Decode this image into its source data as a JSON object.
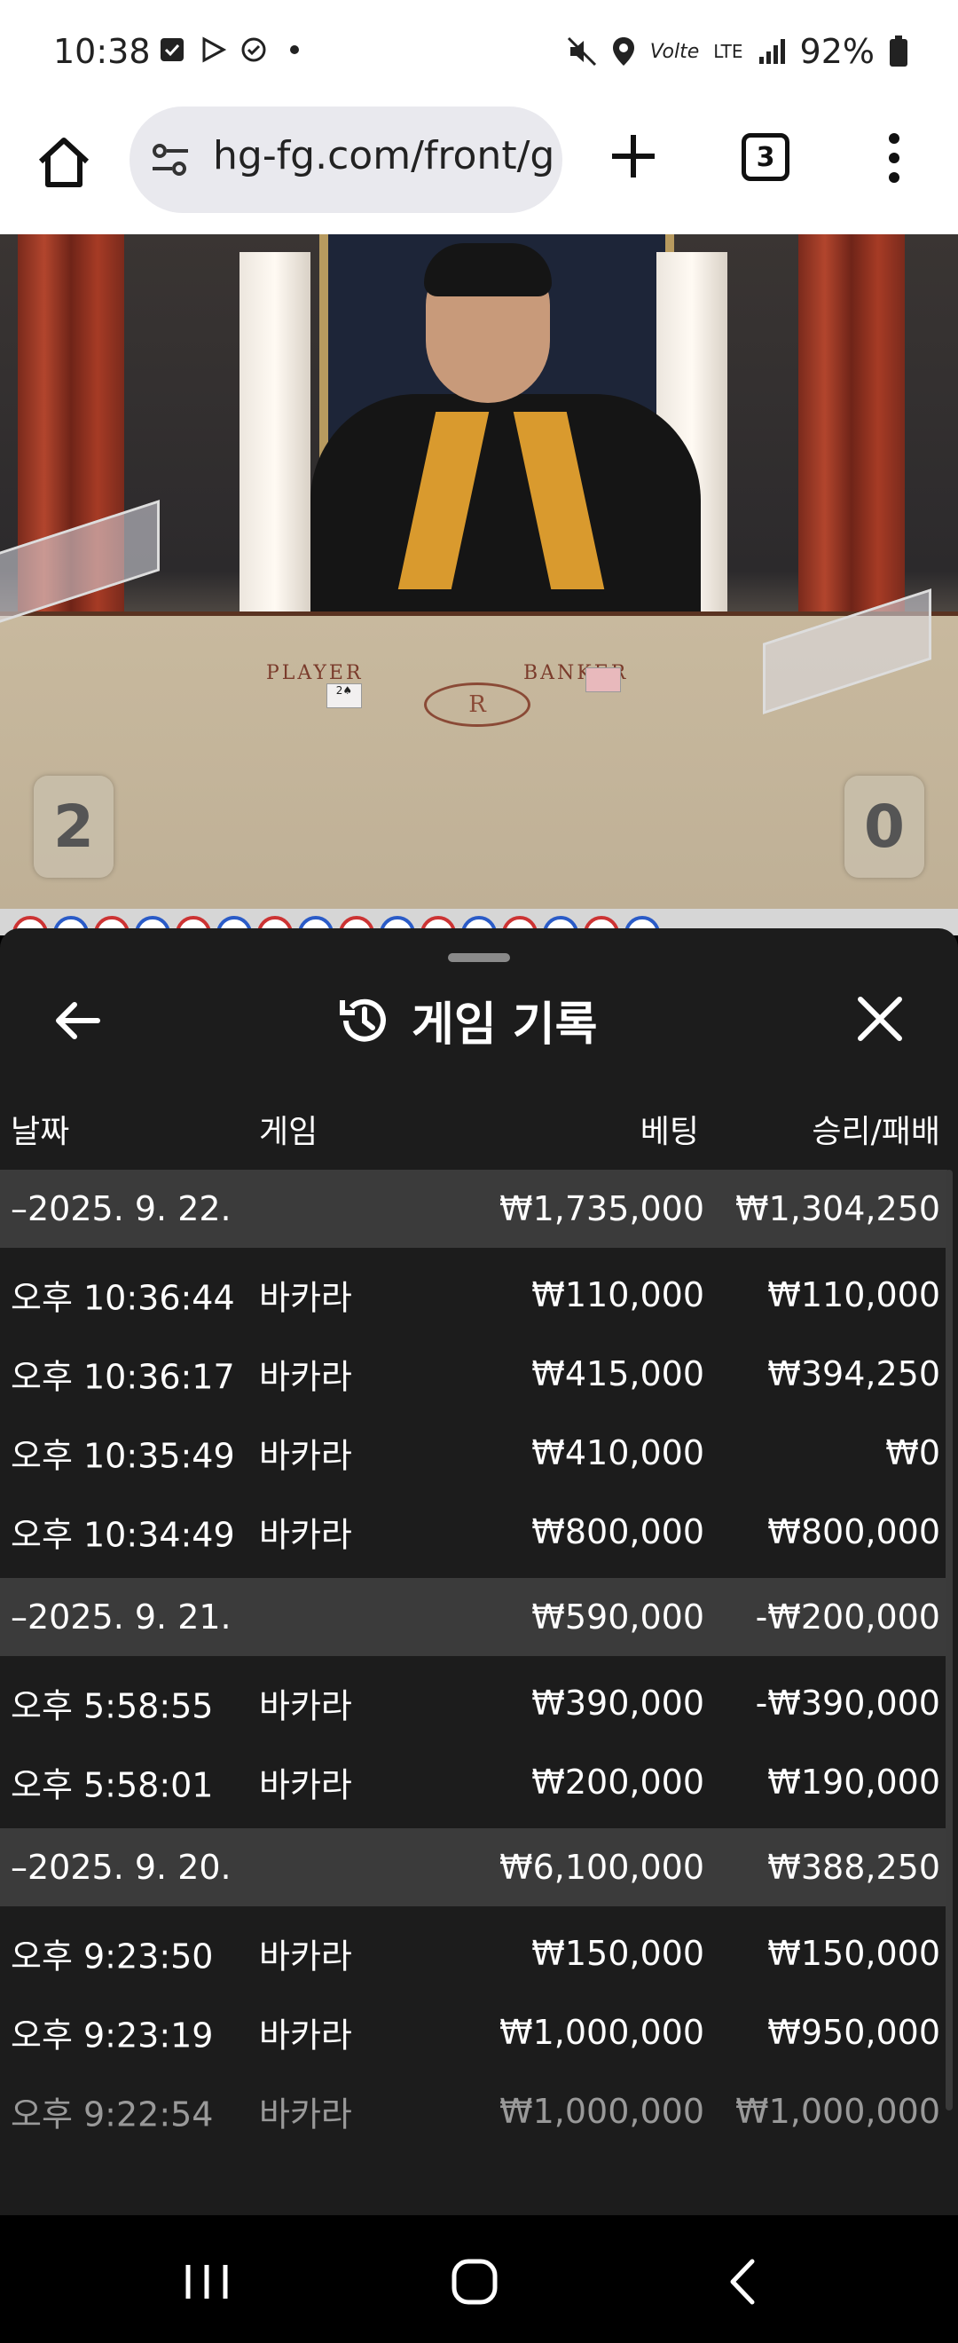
{
  "status_bar": {
    "time": "10:38",
    "battery": "92%",
    "left_icons": [
      "checkbox-notification-icon",
      "play-store-icon",
      "sync-icon",
      "dot-icon"
    ],
    "right_icons": [
      "mute-icon",
      "location-icon",
      "volte-icon",
      "lte-icon",
      "signal-icon",
      "battery-icon"
    ],
    "volte_label": "Volte",
    "lte_label": "LTE"
  },
  "browser": {
    "url": "hg-fg.com/front/g",
    "tab_count": "3",
    "icons": [
      "home-icon",
      "tune-icon",
      "plus-icon",
      "tabs-icon",
      "more-vert-icon"
    ]
  },
  "video": {
    "player_label": "PLAYER",
    "banker_label": "BANKER",
    "player_score": "2",
    "banker_score": "0",
    "card_player": "2♠",
    "table_logo_letter": "R"
  },
  "history": {
    "title": "게임 기록",
    "columns": {
      "date": "날짜",
      "game": "게임",
      "bet": "베팅",
      "result": "승리/패배"
    },
    "groups": [
      {
        "date": "–2025. 9. 22.",
        "bet": "₩1,735,000",
        "result": "₩1,304,250",
        "rows": [
          {
            "time": "오후 10:36:44",
            "game": "바카라",
            "bet": "₩110,000",
            "result": "₩110,000"
          },
          {
            "time": "오후 10:36:17",
            "game": "바카라",
            "bet": "₩415,000",
            "result": "₩394,250"
          },
          {
            "time": "오후 10:35:49",
            "game": "바카라",
            "bet": "₩410,000",
            "result": "₩0"
          },
          {
            "time": "오후 10:34:49",
            "game": "바카라",
            "bet": "₩800,000",
            "result": "₩800,000"
          }
        ]
      },
      {
        "date": "–2025. 9. 21.",
        "bet": "₩590,000",
        "result": "-₩200,000",
        "rows": [
          {
            "time": "오후 5:58:55",
            "game": "바카라",
            "bet": "₩390,000",
            "result": "-₩390,000"
          },
          {
            "time": "오후 5:58:01",
            "game": "바카라",
            "bet": "₩200,000",
            "result": "₩190,000"
          }
        ]
      },
      {
        "date": "–2025. 9. 20.",
        "bet": "₩6,100,000",
        "result": "₩388,250",
        "rows": [
          {
            "time": "오후 9:23:50",
            "game": "바카라",
            "bet": "₩150,000",
            "result": "₩150,000"
          },
          {
            "time": "오후 9:23:19",
            "game": "바카라",
            "bet": "₩1,000,000",
            "result": "₩950,000"
          },
          {
            "time": "오후 9:22:54",
            "game": "바카라",
            "bet": "₩1,000,000",
            "result": "₩1,000,000"
          }
        ]
      }
    ]
  },
  "nav_bar": {
    "icons": [
      "recent-apps-icon",
      "home-circle-icon",
      "back-chevron-icon"
    ]
  },
  "colors": {
    "sheet_bg": "#1c1c1c",
    "group_row_bg": "#3b3b3b",
    "text": "#ffffff",
    "accent_gold": "#d99a2e"
  }
}
